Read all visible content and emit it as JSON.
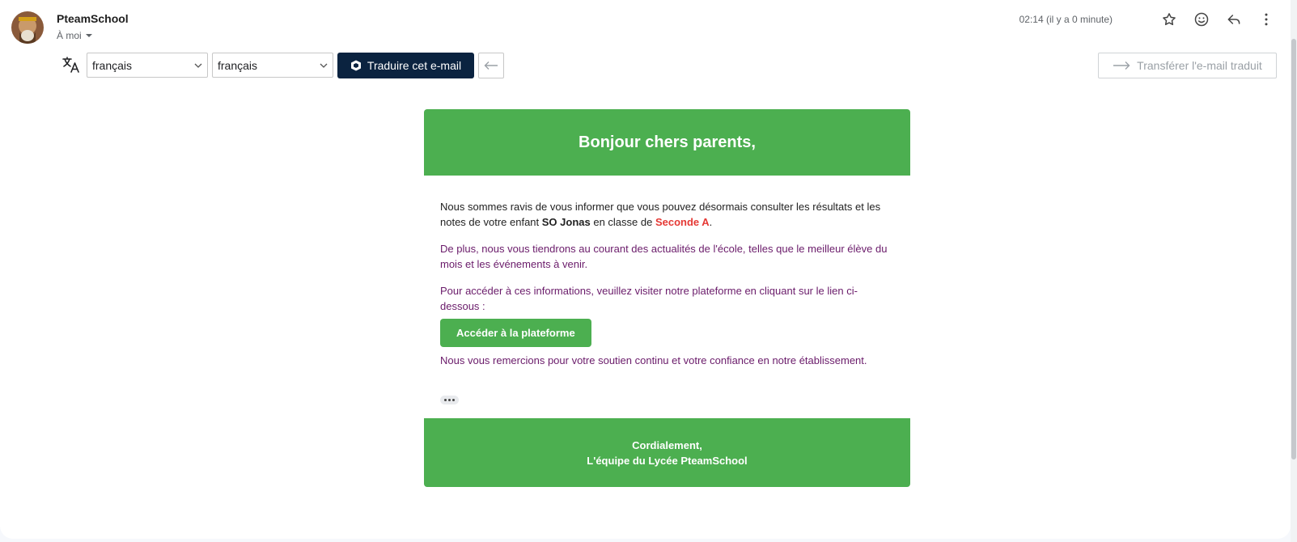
{
  "header": {
    "sender": "PteamSchool",
    "recipient": "À moi",
    "time": "02:14 (il y a 0 minute)",
    "icons": [
      "star-icon",
      "emoji-icon",
      "reply-icon",
      "more-vert-icon"
    ]
  },
  "translate_bar": {
    "source_language": "français",
    "target_language": "français",
    "translate_label": "Traduire cet e-mail",
    "forward_label": "Transférer l'e-mail traduit"
  },
  "email": {
    "title": "Bonjour chers parents,",
    "p1_start": "Nous sommes ravis de vous informer que vous pouvez désormais consulter les résultats et les notes de votre enfant ",
    "student_name": "SO Jonas",
    "p1_mid": " en classe de ",
    "class_name": "Seconde A",
    "p1_end": ".",
    "p2": "De plus, nous vous tiendrons au courant des actualités de l'école, telles que le meilleur élève du mois et les événements à venir.",
    "p3": "Pour accéder à ces informations, veuillez visiter notre plateforme en cliquant sur le lien ci-dessous :",
    "cta_label": "Accéder à la plateforme",
    "p4": "Nous vous remercions pour votre soutien continu et votre confiance en notre établissement.",
    "footer_line1": "Cordialement,",
    "footer_line2": "L'équipe du Lycée PteamSchool"
  },
  "colors": {
    "accent_green": "#4caf50",
    "translate_button": "#0b2340",
    "highlight_red": "#e53935",
    "body_purple": "#6a1b6a"
  }
}
